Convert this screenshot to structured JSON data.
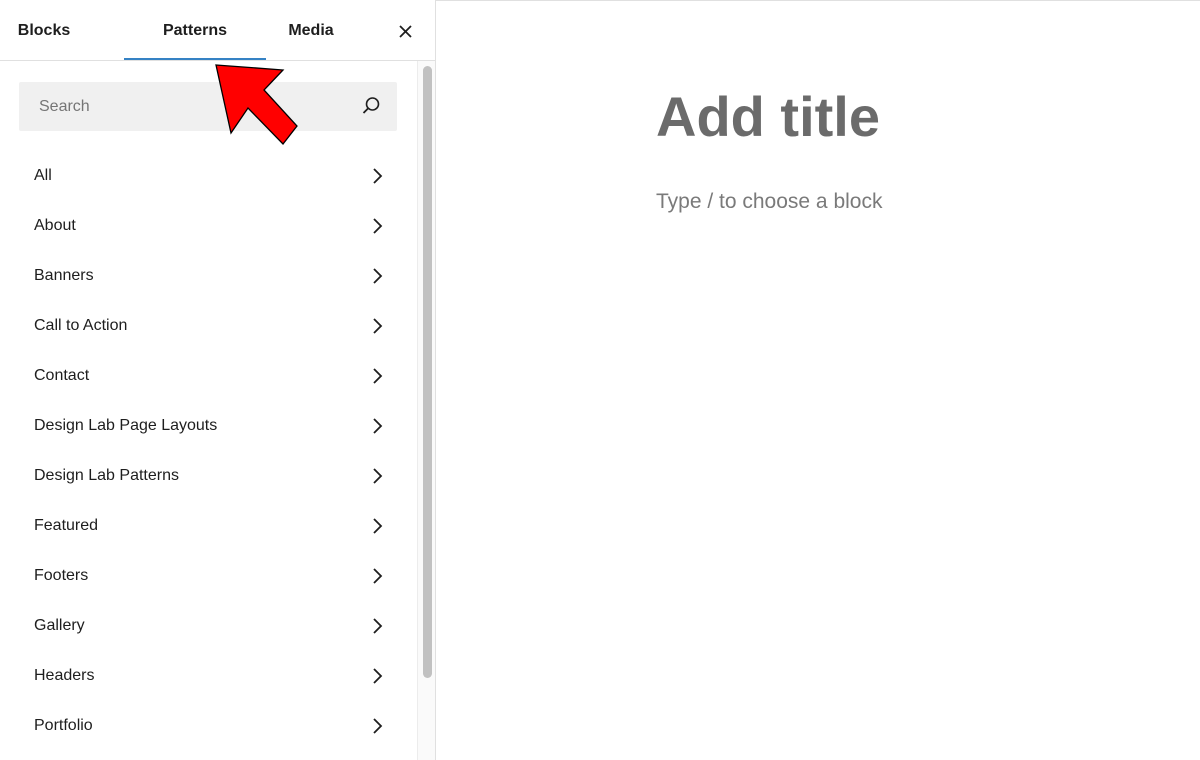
{
  "tabs": [
    {
      "label": "Blocks"
    },
    {
      "label": "Patterns"
    },
    {
      "label": "Media"
    }
  ],
  "active_tab": "Patterns",
  "search": {
    "placeholder": "Search"
  },
  "categories": [
    {
      "label": "All"
    },
    {
      "label": "About"
    },
    {
      "label": "Banners"
    },
    {
      "label": "Call to Action"
    },
    {
      "label": "Contact"
    },
    {
      "label": "Design Lab Page Layouts"
    },
    {
      "label": "Design Lab Patterns"
    },
    {
      "label": "Featured"
    },
    {
      "label": "Footers"
    },
    {
      "label": "Gallery"
    },
    {
      "label": "Headers"
    },
    {
      "label": "Portfolio"
    }
  ],
  "editor": {
    "title_placeholder": "Add title",
    "block_placeholder": "Type / to choose a block"
  },
  "icons": {
    "close": "close-icon",
    "search": "search-icon",
    "chevron": "chevron-right-icon",
    "annotation": "red-arrow-icon"
  },
  "colors": {
    "accent": "#3582c4",
    "annotation": "#ff0000",
    "search_bg": "#f0f0f0",
    "title_text": "#6b6b6b"
  }
}
